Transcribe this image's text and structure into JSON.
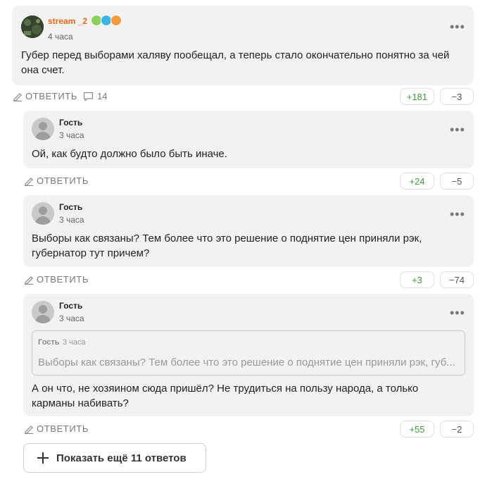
{
  "actions": {
    "reply_label": "ОТВЕТИТЬ"
  },
  "main_comment": {
    "author": "stream _2",
    "time": "4 часа",
    "text": "Губер перед выборами халяву пообещал, а теперь стало окончательно понятно за чей она счет.",
    "replies_count": "14",
    "votes_up": "+181",
    "votes_down": "−3",
    "badge_colors": [
      "#8bd05b",
      "#3ab5e6",
      "#f59a3c"
    ]
  },
  "replies": [
    {
      "author": "Гость",
      "time": "3 часа",
      "text": "Ой, как будто должно было быть иначе.",
      "votes_up": "+24",
      "votes_down": "−5"
    },
    {
      "author": "Гость",
      "time": "3 часа",
      "text": "Выборы как связаны? Тем более что это решение о поднятие цен приняли рэк, губернатор тут причем?",
      "votes_up": "+3",
      "votes_down": "−74"
    },
    {
      "author": "Гость",
      "time": "3 часа",
      "quote": {
        "author": "Гость",
        "time": "3 часа",
        "text": "Выборы как связаны? Тем более что это решение о поднятие цен приняли рэк, губ..."
      },
      "text": "А он что, не хозяином сюда пришёл? Не трудиться на пользу народа, а только карманы набивать?",
      "votes_up": "+55",
      "votes_down": "−2"
    }
  ],
  "show_more": {
    "label": "Показать ещё 11 ответов"
  },
  "colors": {
    "accent_orange": "#ef6a11",
    "vote_up_green": "#3d9a3d",
    "card_bg": "#f2f2f2"
  }
}
